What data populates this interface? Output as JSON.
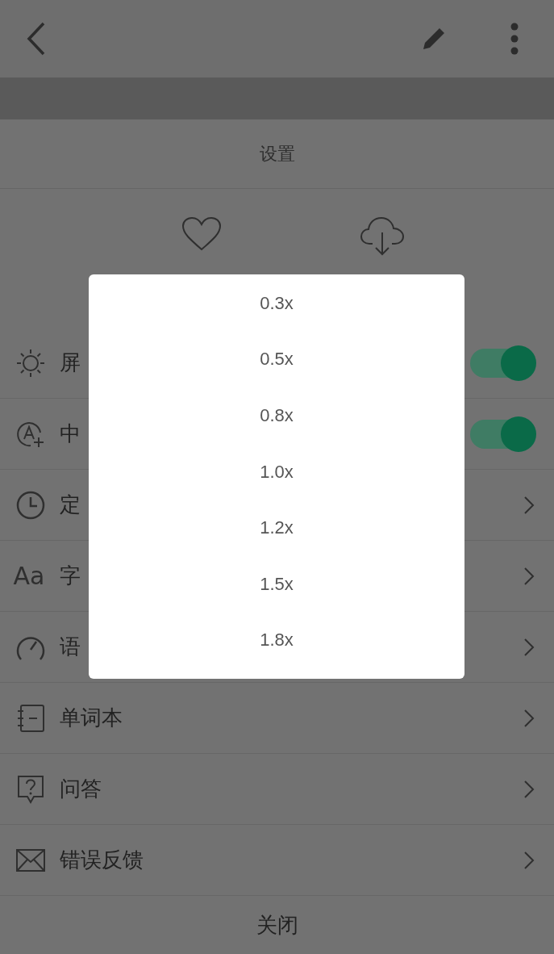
{
  "sheet_title": "设置",
  "rows": [
    {
      "kind": "toggle",
      "label": "屏",
      "on": true
    },
    {
      "kind": "toggle",
      "label": "中",
      "on": true
    },
    {
      "kind": "link",
      "label": "定"
    },
    {
      "kind": "link",
      "icon_text": "Aa",
      "label": "字"
    },
    {
      "kind": "link",
      "label": "语"
    },
    {
      "kind": "link",
      "label": "单词本"
    },
    {
      "kind": "link",
      "label": "问答"
    },
    {
      "kind": "link",
      "label": "错误反馈"
    }
  ],
  "close_button": "关闭",
  "speed_options": [
    {
      "label": "0.3x"
    },
    {
      "label": "0.5x"
    },
    {
      "label": "0.8x"
    },
    {
      "label": "1.0x"
    },
    {
      "label": "1.2x"
    },
    {
      "label": "1.5x"
    },
    {
      "label": "1.8x"
    }
  ]
}
